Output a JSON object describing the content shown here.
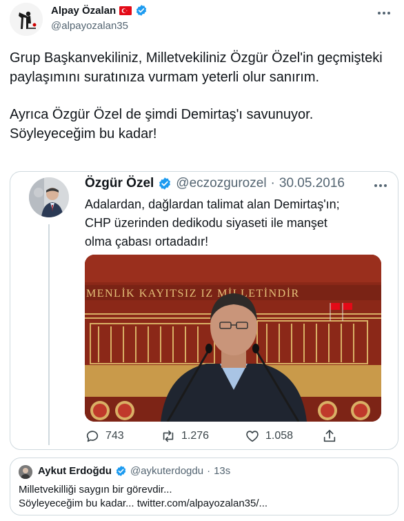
{
  "author": {
    "name": "Alpay Özalan",
    "handle": "@alpayozalan35"
  },
  "tweet": {
    "paragraph_1": "Grup Başkanvekiliniz, Milletvekiliniz Özgür Özel'in geçmişteki paylaşımını suratınıza vurmam yeterli olur sanırım.",
    "paragraph_2": "Ayrıca Özgür Özel de şimdi Demirtaş'ı savunuyor. Söyleyeceğim bu kadar!"
  },
  "embedded_tweet": {
    "name": "Özgür Özel",
    "handle": "@eczozgurozel",
    "separator": "·",
    "date": "30.05.2016",
    "text_line_1": "Adalardan, dağlardan talimat alan Demirtaş'ın;",
    "text_line_2": "CHP üzerinden  dedikodu siyaseti ile manşet",
    "text_line_3": "olma çabası ortadadır!",
    "banner_text": "MENLİK KAYITSIZ   IZ MİLLETİNDİR",
    "replies": "743",
    "retweets": "1.276",
    "likes": "1.058"
  },
  "quote_tweet": {
    "name": "Aykut Erdoğdu",
    "handle": "@aykuterdogdu",
    "separator": "·",
    "time": "13s",
    "text_line_1": "Milletvekilliği saygın bir görevdir...",
    "text_line_2": "Söyleyeceğim bu kadar... twitter.com/alpayozalan35/..."
  },
  "icons": {
    "flag": "turkey-flag-icon",
    "verified": "verified-badge-icon",
    "more": "more-icon",
    "reply": "reply-icon",
    "retweet": "retweet-icon",
    "like": "like-icon",
    "share": "share-icon"
  },
  "colors": {
    "verified_blue": "#1d9bf0",
    "secondary_text": "#536471",
    "border": "#cfd9de",
    "photo_red": "#8f2a1c",
    "flag_red": "#e30a17"
  }
}
